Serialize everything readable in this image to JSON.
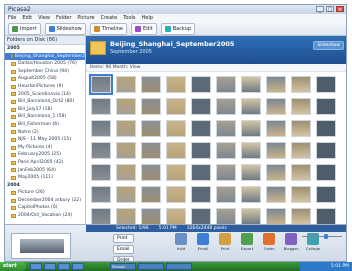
{
  "window": {
    "title": "Picasa2"
  },
  "menu": [
    "File",
    "Edit",
    "View",
    "Folder",
    "Picture",
    "Create",
    "Tools",
    "Help"
  ],
  "toolbar": {
    "import": "Import",
    "slideshow": "Slideshow",
    "timeline": "Timeline",
    "edit": "Edit",
    "backup": "Backup"
  },
  "left_pane": {
    "header": "Folders on Disk (86)",
    "items": [
      {
        "label": "2005",
        "type": "cat"
      },
      {
        "label": "Beijing_Shanghai_September2005",
        "type": "sel"
      },
      {
        "label": "Dallas/Houston 2005 (76)",
        "type": "item"
      },
      {
        "label": "September China (94)",
        "type": "item"
      },
      {
        "label": "August2005 (58)",
        "type": "item"
      },
      {
        "label": "HoustonPictures (9)",
        "type": "item"
      },
      {
        "label": "2005_Scandinavia (14)",
        "type": "item"
      },
      {
        "label": "Bill_Barcelona_Oct2 (80)",
        "type": "item"
      },
      {
        "label": "Bill_July17 (18)",
        "type": "item"
      },
      {
        "label": "Bill_Barcelona_1 (58)",
        "type": "item"
      },
      {
        "label": "Bill_Fisherman (6)",
        "type": "item"
      },
      {
        "label": "Natre (2)",
        "type": "item"
      },
      {
        "label": "NJS - 11 May 2005 (15)",
        "type": "item"
      },
      {
        "label": "My Pictures (4)",
        "type": "item"
      },
      {
        "label": "February2005 (25)",
        "type": "item"
      },
      {
        "label": "Paris April2005 (42)",
        "type": "item"
      },
      {
        "label": "JanFeb2005 (64)",
        "type": "item"
      },
      {
        "label": "May2005 (111)",
        "type": "item"
      },
      {
        "label": "2004",
        "type": "cat"
      },
      {
        "label": "Picture (26)",
        "type": "item"
      },
      {
        "label": "December2004 arbury (22)",
        "type": "item"
      },
      {
        "label": "CapitolPhotos (6)",
        "type": "item"
      },
      {
        "label": "2004/Oct_Vacation (24)",
        "type": "item"
      }
    ]
  },
  "album": {
    "title": "Beijing_Shanghai_September2005",
    "subtitle": "September 2005",
    "button": "Slideshow",
    "sort": "Items: 96 Month: View"
  },
  "status": {
    "a": "Selected: 1/96",
    "b": "5:01 PM",
    "c": "3264x2448 pixels"
  },
  "actions": [
    "Print",
    "Email",
    "Order"
  ],
  "tasks": [
    "Hold",
    "Email",
    "Print",
    "Export",
    "Order",
    "Blogger",
    "Collage"
  ],
  "taskbar": {
    "start": "start",
    "clock": "5:01 PM"
  },
  "thumb_colors": [
    "#6f7a85",
    "#b8a37a",
    "#8a8f94",
    "#c9b38a",
    "#5c6a78",
    "#a7a092",
    "#d2c4a3",
    "#7d8791",
    "#9e8f73",
    "#4f5d6a"
  ],
  "colors": {
    "accent": "#3d7fd6",
    "header": "#1f4f8f",
    "taskbar": "#2d8a2d"
  }
}
